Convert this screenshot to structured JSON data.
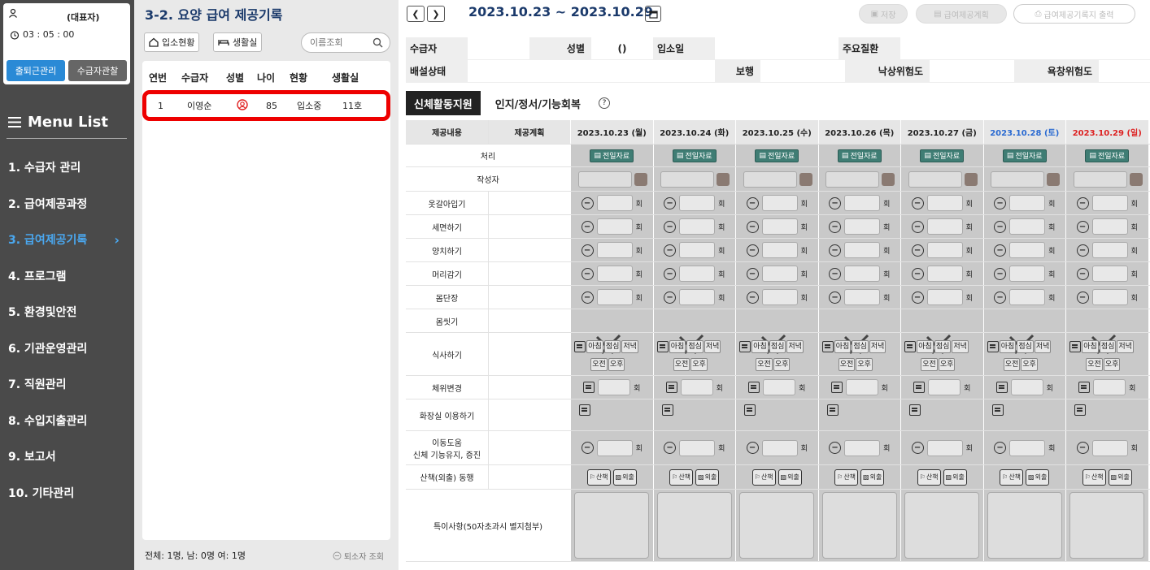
{
  "user": {
    "name": "",
    "role": "(대표자)",
    "timer": "03 : 05 : 00",
    "btn_attendance": "출퇴근관리",
    "btn_observation": "수급자관찰"
  },
  "menu": {
    "title": "Menu List",
    "items": [
      {
        "label": "1. 수급자 관리",
        "active": false
      },
      {
        "label": "2. 급여제공과정",
        "active": false
      },
      {
        "label": "3. 급여제공기록",
        "active": true
      },
      {
        "label": "4. 프로그램",
        "active": false
      },
      {
        "label": "5. 환경및안전",
        "active": false
      },
      {
        "label": "6. 기관운영관리",
        "active": false
      },
      {
        "label": "7. 직원관리",
        "active": false
      },
      {
        "label": "8. 수입지출관리",
        "active": false
      },
      {
        "label": "9. 보고서",
        "active": false
      },
      {
        "label": "10. 기타관리",
        "active": false
      }
    ]
  },
  "list": {
    "title": "3-2. 요양 급여 제공기록",
    "tab_admission": "입소현황",
    "tab_room": "생활실",
    "search_placeholder": "이름조회",
    "headers": [
      "연번",
      "수급자",
      "성별",
      "나이",
      "현황",
      "생활실"
    ],
    "rows": [
      {
        "no": "1",
        "name": "이영순",
        "gender": "female",
        "age": "85",
        "status": "입소중",
        "room": "11호"
      }
    ],
    "footer": "전체: 1명, 남: 0명 여: 1명",
    "retired_label": "퇴소자 조회"
  },
  "main": {
    "date_range": "2023.10.23 ~ 2023.10.29",
    "btn_save": "저장",
    "btn_plan": "급여제공계획",
    "btn_print": "급여제공기록지 출력",
    "info": {
      "recipient": "수급자",
      "gender": "성별",
      "gender_val": "()",
      "admission": "입소일",
      "disease": "주요질환",
      "excretion": "배설상태",
      "walking": "보행",
      "fall_risk": "낙상위험도",
      "bedsore_risk": "욕창위험도"
    },
    "tabs": [
      "신체활동지원",
      "인지/정서/기능회복"
    ],
    "col_content": "제공내용",
    "col_plan": "제공계획",
    "days": [
      {
        "label": "2023.10.23 (월)",
        "type": "weekday"
      },
      {
        "label": "2023.10.24 (화)",
        "type": "weekday"
      },
      {
        "label": "2023.10.25 (수)",
        "type": "weekday"
      },
      {
        "label": "2023.10.26 (목)",
        "type": "weekday"
      },
      {
        "label": "2023.10.27 (금)",
        "type": "weekday"
      },
      {
        "label": "2023.10.28 (토)",
        "type": "sat"
      },
      {
        "label": "2023.10.29 (일)",
        "type": "sun"
      }
    ],
    "prev_label": "전일자료",
    "unit": "회",
    "meal_labels": [
      "아침",
      "점심",
      "저녁",
      "오전",
      "오후"
    ],
    "walk_label": "산책",
    "out_label": "외출",
    "rows": {
      "process": "처리",
      "writer": "작성자",
      "dress": "옷갈아입기",
      "wash": "세면하기",
      "teeth": "양치하기",
      "hair": "머리감기",
      "groom": "몸단장",
      "bath": "몸씻기",
      "meal": "식사하기",
      "pos": "체위변경",
      "toilet": "화장실 이용하기",
      "move1": "이동도움",
      "move2": "신체 기능유지, 증진",
      "walkout": "산책(외출) 동행",
      "note": "특이사항(50자초과시 별지첨부)"
    }
  }
}
